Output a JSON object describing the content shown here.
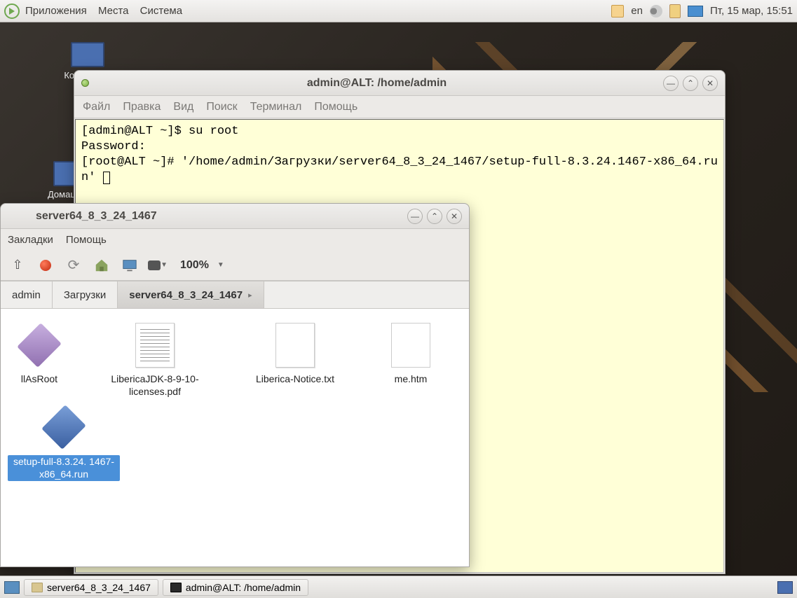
{
  "panel": {
    "menus": [
      "Приложения",
      "Места",
      "Система"
    ],
    "lang": "en",
    "clock": "Пт, 15 мар, 15:51"
  },
  "desktop": {
    "icons": [
      {
        "label": "Компьютер"
      },
      {
        "label": "Домашняя"
      }
    ]
  },
  "terminal": {
    "title": "admin@ALT: /home/admin",
    "menus": [
      "Файл",
      "Правка",
      "Вид",
      "Поиск",
      "Терминал",
      "Помощь"
    ],
    "lines": [
      "[admin@ALT ~]$ su root",
      "Password:",
      "[root@ALT ~]# '/home/admin/Загрузки/server64_8_3_24_1467/setup-full-8.3.24.1467-x86_64.run' "
    ]
  },
  "fm": {
    "title": "server64_8_3_24_1467",
    "menus": [
      "Закладки",
      "Помощь"
    ],
    "zoom": "100%",
    "path": [
      {
        "label": "admin",
        "active": false
      },
      {
        "label": "Загрузки",
        "active": false
      },
      {
        "label": "server64_8_3_24_1467",
        "active": true
      }
    ],
    "files": [
      {
        "name": "llAsRoot",
        "kind": "exe",
        "selected": false
      },
      {
        "name": "LibericaJDK-8-9-10-licenses.pdf",
        "kind": "pdf",
        "selected": false
      },
      {
        "name": "Liberica-Notice.txt",
        "kind": "txt",
        "selected": false
      },
      {
        "name": "me.htm",
        "kind": "htm",
        "selected": false
      },
      {
        "name": "setup-full-8.3.24. 1467-x86_64.run",
        "kind": "run",
        "selected": true
      }
    ]
  },
  "taskbar": {
    "tasks": [
      {
        "label": "server64_8_3_24_1467",
        "icon": "folder"
      },
      {
        "label": "admin@ALT: /home/admin",
        "icon": "terminal"
      }
    ]
  }
}
